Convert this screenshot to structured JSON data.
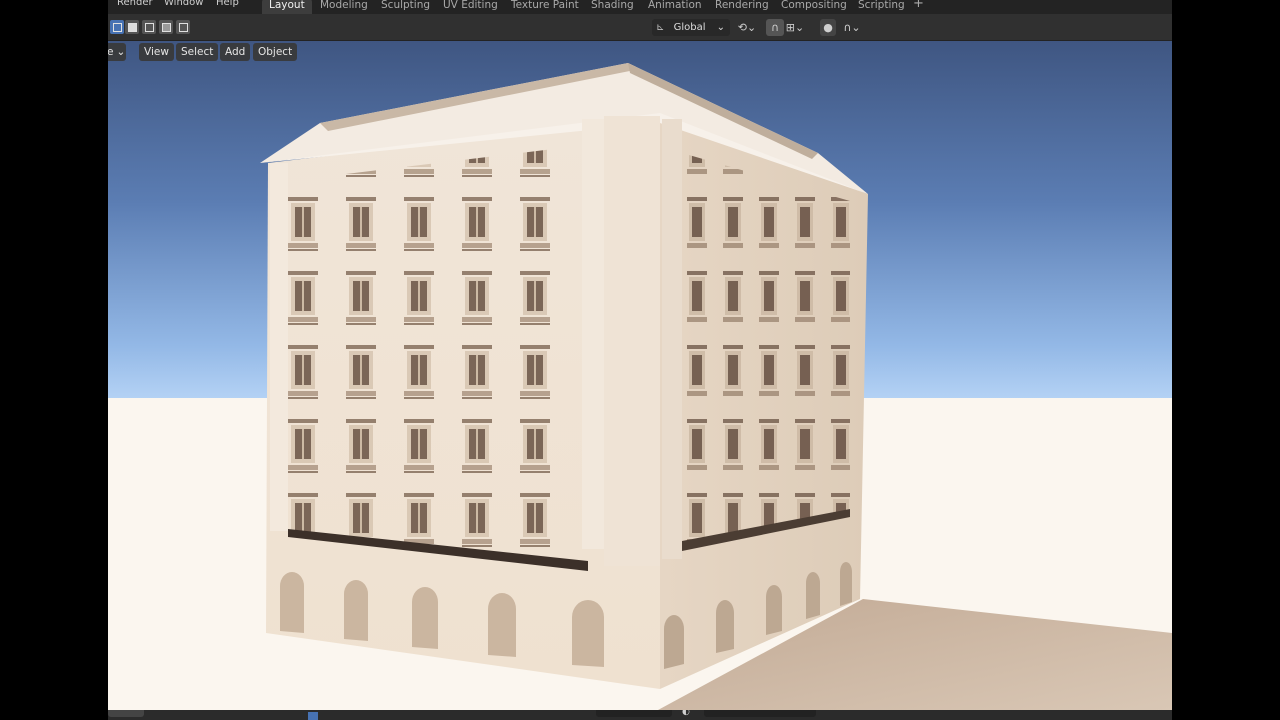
{
  "menu": [
    "Render",
    "Window",
    "Help"
  ],
  "workspace_tabs": [
    {
      "label": "Layout",
      "active": true
    },
    {
      "label": "Modeling"
    },
    {
      "label": "Sculpting"
    },
    {
      "label": "UV Editing"
    },
    {
      "label": "Texture Paint"
    },
    {
      "label": "Shading"
    },
    {
      "label": "Animation"
    },
    {
      "label": "Rendering"
    },
    {
      "label": "Compositing"
    },
    {
      "label": "Scripting"
    }
  ],
  "header": {
    "transform_orientation": "Global",
    "mode_partial": "e"
  },
  "viewport_menu": [
    "View",
    "Select",
    "Add",
    "Object"
  ],
  "colors": {
    "accent": "#4772b3",
    "sky_top": "#3f5784",
    "sky_horizon": "#a9c8ef",
    "ground": "#fbf6ef",
    "building": "#ece0d2"
  },
  "icons": [
    "select-box-icon",
    "snap-icon",
    "proportional-edit-icon",
    "pivot-icon",
    "transform-orientation-icon"
  ]
}
